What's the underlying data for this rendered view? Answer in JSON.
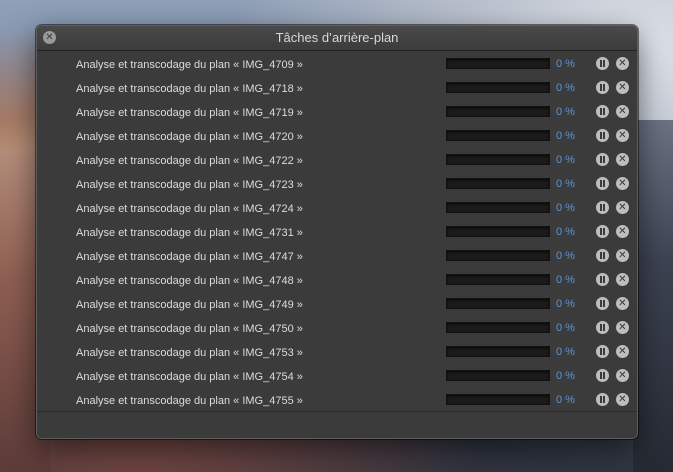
{
  "window": {
    "title": "Tâches d’arrière-plan"
  },
  "tasks": [
    {
      "label": "Analyse et transcodage du plan « IMG_4709 »",
      "percent": "0 %",
      "progress": 0
    },
    {
      "label": "Analyse et transcodage du plan « IMG_4718 »",
      "percent": "0 %",
      "progress": 0
    },
    {
      "label": "Analyse et transcodage du plan « IMG_4719 »",
      "percent": "0 %",
      "progress": 0
    },
    {
      "label": "Analyse et transcodage du plan « IMG_4720 »",
      "percent": "0 %",
      "progress": 0
    },
    {
      "label": "Analyse et transcodage du plan « IMG_4722 »",
      "percent": "0 %",
      "progress": 0
    },
    {
      "label": "Analyse et transcodage du plan « IMG_4723 »",
      "percent": "0 %",
      "progress": 0
    },
    {
      "label": "Analyse et transcodage du plan « IMG_4724 »",
      "percent": "0 %",
      "progress": 0
    },
    {
      "label": "Analyse et transcodage du plan « IMG_4731 »",
      "percent": "0 %",
      "progress": 0
    },
    {
      "label": "Analyse et transcodage du plan « IMG_4747 »",
      "percent": "0 %",
      "progress": 0
    },
    {
      "label": "Analyse et transcodage du plan « IMG_4748 »",
      "percent": "0 %",
      "progress": 0
    },
    {
      "label": "Analyse et transcodage du plan « IMG_4749 »",
      "percent": "0 %",
      "progress": 0
    },
    {
      "label": "Analyse et transcodage du plan « IMG_4750 »",
      "percent": "0 %",
      "progress": 0
    },
    {
      "label": "Analyse et transcodage du plan « IMG_4753 »",
      "percent": "0 %",
      "progress": 0
    },
    {
      "label": "Analyse et transcodage du plan « IMG_4754 »",
      "percent": "0 %",
      "progress": 0
    },
    {
      "label": "Analyse et transcodage du plan « IMG_4755 »",
      "percent": "0 %",
      "progress": 0
    }
  ],
  "icons": {
    "close": "close-icon",
    "pause": "pause-icon",
    "cancel": "cancel-icon"
  },
  "colors": {
    "accent_percent": "#5a95d6",
    "window_bg": "#3b3b3b",
    "progress_track": "#1b1b1b"
  }
}
